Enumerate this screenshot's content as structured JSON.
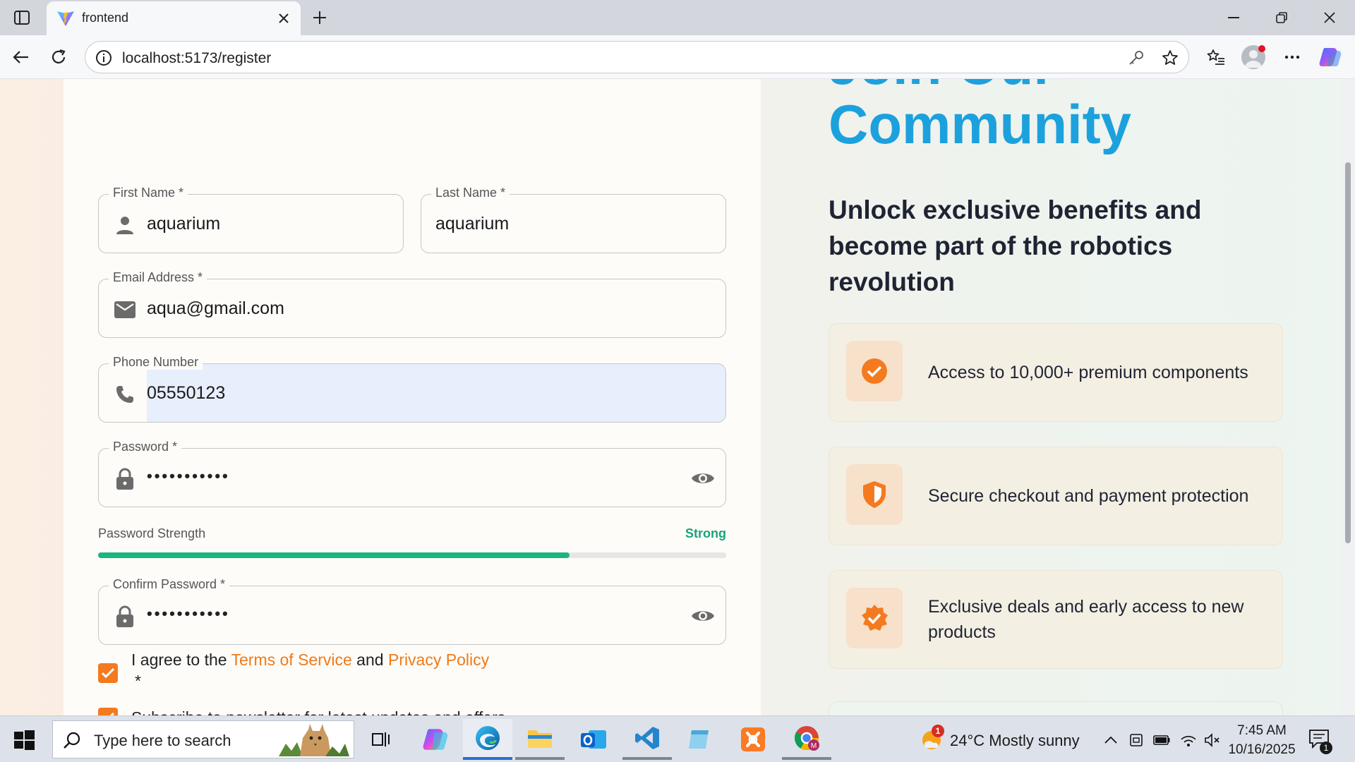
{
  "browser": {
    "tab_title": "frontend",
    "url": "localhost:5173/register",
    "favicon": "vite-logo-icon"
  },
  "form": {
    "first_name": {
      "label": "First Name *",
      "value": "aquarium",
      "icon": "person-icon"
    },
    "last_name": {
      "label": "Last Name *",
      "value": "aquarium"
    },
    "email": {
      "label": "Email Address *",
      "value": "aqua@gmail.com",
      "icon": "mail-icon"
    },
    "phone": {
      "label": "Phone Number",
      "value": "05550123",
      "icon": "phone-icon"
    },
    "password": {
      "label": "Password *",
      "value": "•••••••••••",
      "icon": "lock-icon"
    },
    "strength": {
      "label": "Password Strength",
      "value": "Strong",
      "level": 0.75,
      "color": "#19b67f"
    },
    "confirm_password": {
      "label": "Confirm Password *",
      "value": "•••••••••••",
      "icon": "lock-icon"
    },
    "terms": {
      "prefix": "I agree to the ",
      "terms_link": "Terms of Service",
      "middle": " and ",
      "privacy_link": "Privacy Policy",
      "required_mark": "*",
      "checked": true
    },
    "newsletter": {
      "label": "Subscribe to newsletter for latest updates and offers",
      "checked": true
    }
  },
  "hero": {
    "title_line1": "Join Our",
    "title_line2": "Community",
    "subtitle": "Unlock exclusive benefits and become part of the robotics revolution",
    "accent_color": "#1da1dd",
    "features": [
      {
        "icon": "check-circle-icon",
        "text": "Access to 10,000+ premium components"
      },
      {
        "icon": "shield-icon",
        "text": "Secure checkout and payment protection"
      },
      {
        "icon": "verified-badge-icon",
        "text": "Exclusive deals and early access to new products"
      }
    ]
  },
  "taskbar": {
    "search_placeholder": "Type here to search",
    "weather": "24°C  Mostly sunny",
    "weather_badge": "1",
    "time": "7:45 AM",
    "date": "10/16/2025",
    "notification_count": "1"
  }
}
